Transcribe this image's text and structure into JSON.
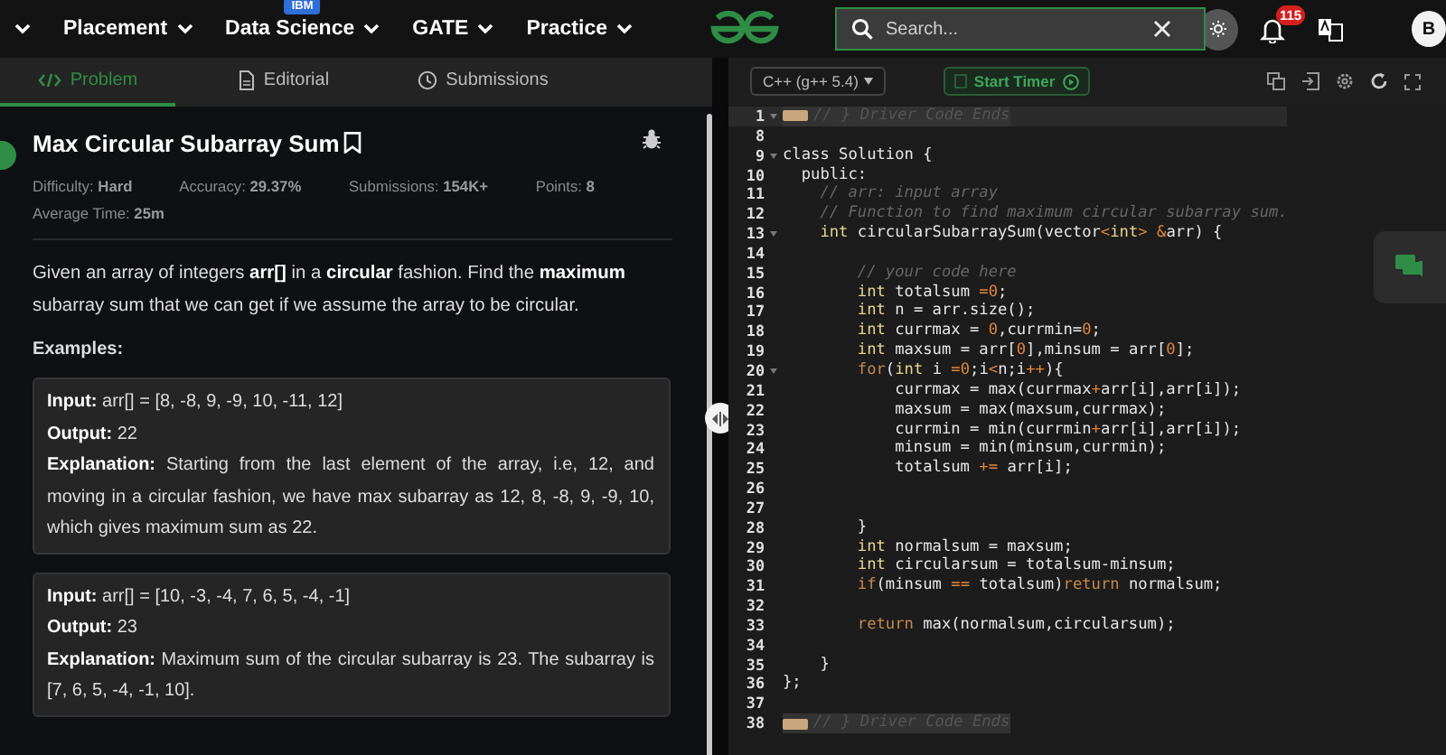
{
  "nav": {
    "links": [
      {
        "label": "Placement"
      },
      {
        "label": "Data Science",
        "badge": "IBM"
      },
      {
        "label": "GATE"
      },
      {
        "label": "Practice"
      }
    ],
    "search": {
      "placeholder": "Search..."
    },
    "notifications": {
      "count": "115"
    },
    "avatar": {
      "initial": "B"
    }
  },
  "tabs": [
    {
      "label": "Problem",
      "kind": "code",
      "selected": true
    },
    {
      "label": "Editorial",
      "kind": "document",
      "selected": false
    },
    {
      "label": "Submissions",
      "kind": "clock",
      "selected": false
    }
  ],
  "problem": {
    "title": "Max Circular Subarray Sum",
    "stats": [
      "Difficulty: **Hard**",
      "Accuracy: **29.37%**",
      "Submissions: **154K+**",
      "Points: **8**",
      "Average Time: **25m**"
    ],
    "description": "Given an array of integers **arr[]** in a **circular** fashion. Find the **maximum** subarray sum that we can get if we assume the array to be circular.",
    "examples_heading": "Examples:",
    "examples": [
      {
        "lines": [
          "**Input:** arr[] = [8, -8, 9, -9, 10, -11, 12]",
          "**Output:** 22",
          "**Explanation:** Starting from the last element of the array, i.e, 12, and moving in a circular fashion, we have max subarray as 12, 8, -8, 9, -9, 10, which gives maximum sum as 22."
        ]
      },
      {
        "lines": [
          "**Input:** arr[] = [10, -3, -4, 7, 6, 5, -4, -1]",
          "**Output:** 23",
          "**Explanation:** Maximum sum of the circular subarray is 23. The subarray is [7, 6, 5, -4, -1, 10]."
        ]
      }
    ]
  },
  "editor": {
    "language": "C++ (g++ 5.4)",
    "timer_button": "Start Timer",
    "lines": [
      {
        "number": "1",
        "kind": "folded",
        "foldable": true,
        "active": true,
        "tokens": [
          {
            "kind": "comment",
            "text": "// } Driver Code Ends"
          }
        ]
      },
      {
        "number": "8",
        "kind": "code",
        "foldable": false,
        "active": false
      },
      {
        "number": "9",
        "kind": "code",
        "foldable": true,
        "active": false,
        "tokens": [
          {
            "kind": "plain",
            "text": "class Solution {"
          }
        ]
      },
      {
        "number": "10",
        "kind": "code",
        "foldable": false,
        "active": false,
        "tokens": [
          {
            "kind": "plain",
            "text": "  public:"
          }
        ]
      },
      {
        "number": "11",
        "kind": "code",
        "foldable": false,
        "active": false,
        "tokens": [
          {
            "kind": "comment",
            "text": "    // arr: input array"
          }
        ]
      },
      {
        "number": "12",
        "kind": "code",
        "foldable": false,
        "active": false,
        "tokens": [
          {
            "kind": "comment",
            "text": "    // Function to find maximum circular subarray sum."
          }
        ]
      },
      {
        "number": "13",
        "kind": "code",
        "foldable": true,
        "active": false,
        "tokens": [
          {
            "kind": "type",
            "text": "    int"
          },
          {
            "kind": "plain",
            "text": " circularSubarraySum(vector"
          },
          {
            "kind": "operator",
            "text": "<"
          },
          {
            "kind": "type",
            "text": "int"
          },
          {
            "kind": "operator",
            "text": ">"
          },
          {
            "kind": "operator",
            "text": " &"
          },
          {
            "kind": "plain",
            "text": "arr) {"
          }
        ]
      },
      {
        "number": "14",
        "kind": "code",
        "foldable": false,
        "active": false
      },
      {
        "number": "15",
        "kind": "code",
        "foldable": false,
        "active": false,
        "tokens": [
          {
            "kind": "comment",
            "text": "        // your code here"
          }
        ]
      },
      {
        "number": "16",
        "kind": "code",
        "foldable": false,
        "active": false,
        "tokens": [
          {
            "kind": "type",
            "text": "        int"
          },
          {
            "kind": "plain",
            "text": " totalsum "
          },
          {
            "kind": "operator",
            "text": "=0"
          },
          {
            "kind": "plain",
            "text": ";"
          }
        ]
      },
      {
        "number": "17",
        "kind": "code",
        "foldable": false,
        "active": false,
        "tokens": [
          {
            "kind": "type",
            "text": "        int"
          },
          {
            "kind": "plain",
            "text": " n = arr.size();"
          }
        ]
      },
      {
        "number": "18",
        "kind": "code",
        "foldable": false,
        "active": false,
        "tokens": [
          {
            "kind": "type",
            "text": "        int"
          },
          {
            "kind": "plain",
            "text": " currmax = "
          },
          {
            "kind": "operator",
            "text": "0"
          },
          {
            "kind": "plain",
            "text": ",currmin="
          },
          {
            "kind": "operator",
            "text": "0"
          },
          {
            "kind": "plain",
            "text": ";"
          }
        ]
      },
      {
        "number": "19",
        "kind": "code",
        "foldable": false,
        "active": false,
        "tokens": [
          {
            "kind": "type",
            "text": "        int"
          },
          {
            "kind": "plain",
            "text": " maxsum = arr["
          },
          {
            "kind": "operator",
            "text": "0"
          },
          {
            "kind": "plain",
            "text": "],minsum = arr["
          },
          {
            "kind": "operator",
            "text": "0"
          },
          {
            "kind": "plain",
            "text": "];"
          }
        ]
      },
      {
        "number": "20",
        "kind": "code",
        "foldable": true,
        "active": false,
        "tokens": [
          {
            "kind": "control",
            "text": "        for"
          },
          {
            "kind": "plain",
            "text": "("
          },
          {
            "kind": "type",
            "text": "int"
          },
          {
            "kind": "plain",
            "text": " i "
          },
          {
            "kind": "operator",
            "text": "=0"
          },
          {
            "kind": "plain",
            "text": ";i"
          },
          {
            "kind": "operator",
            "text": "<"
          },
          {
            "kind": "plain",
            "text": "n;i"
          },
          {
            "kind": "operator",
            "text": "++"
          },
          {
            "kind": "plain",
            "text": "){"
          }
        ]
      },
      {
        "number": "21",
        "kind": "code",
        "foldable": false,
        "active": false,
        "tokens": [
          {
            "kind": "plain",
            "text": "            currmax = max(currmax"
          },
          {
            "kind": "operator",
            "text": "+"
          },
          {
            "kind": "plain",
            "text": "arr[i],arr[i]);"
          }
        ]
      },
      {
        "number": "22",
        "kind": "code",
        "foldable": false,
        "active": false,
        "tokens": [
          {
            "kind": "plain",
            "text": "            maxsum = max(maxsum,currmax);"
          }
        ]
      },
      {
        "number": "23",
        "kind": "code",
        "foldable": false,
        "active": false,
        "tokens": [
          {
            "kind": "plain",
            "text": "            currmin = min(currmin"
          },
          {
            "kind": "operator",
            "text": "+"
          },
          {
            "kind": "plain",
            "text": "arr[i],arr[i]);"
          }
        ]
      },
      {
        "number": "24",
        "kind": "code",
        "foldable": false,
        "active": false,
        "tokens": [
          {
            "kind": "plain",
            "text": "            minsum = min(minsum,currmin);"
          }
        ]
      },
      {
        "number": "25",
        "kind": "code",
        "foldable": false,
        "active": false,
        "tokens": [
          {
            "kind": "plain",
            "text": "            totalsum "
          },
          {
            "kind": "operator",
            "text": "+="
          },
          {
            "kind": "plain",
            "text": " arr[i];"
          }
        ]
      },
      {
        "number": "26",
        "kind": "code",
        "foldable": false,
        "active": false
      },
      {
        "number": "27",
        "kind": "code",
        "foldable": false,
        "active": false
      },
      {
        "number": "28",
        "kind": "code",
        "foldable": false,
        "active": false,
        "tokens": [
          {
            "kind": "plain",
            "text": "        }"
          }
        ]
      },
      {
        "number": "29",
        "kind": "code",
        "foldable": false,
        "active": false,
        "tokens": [
          {
            "kind": "type",
            "text": "        int"
          },
          {
            "kind": "plain",
            "text": " normalsum = maxsum;"
          }
        ]
      },
      {
        "number": "30",
        "kind": "code",
        "foldable": false,
        "active": false,
        "tokens": [
          {
            "kind": "type",
            "text": "        int"
          },
          {
            "kind": "plain",
            "text": " circularsum = totalsum-minsum;"
          }
        ]
      },
      {
        "number": "31",
        "kind": "code",
        "foldable": false,
        "active": false,
        "tokens": [
          {
            "kind": "control",
            "text": "        if"
          },
          {
            "kind": "plain",
            "text": "(minsum "
          },
          {
            "kind": "operator",
            "text": "=="
          },
          {
            "kind": "plain",
            "text": " totalsum)"
          },
          {
            "kind": "control",
            "text": "return"
          },
          {
            "kind": "plain",
            "text": " normalsum;"
          }
        ]
      },
      {
        "number": "32",
        "kind": "code",
        "foldable": false,
        "active": false
      },
      {
        "number": "33",
        "kind": "code",
        "foldable": false,
        "active": false,
        "tokens": [
          {
            "kind": "control",
            "text": "        return"
          },
          {
            "kind": "plain",
            "text": " max(normalsum,circularsum);"
          }
        ]
      },
      {
        "number": "34",
        "kind": "code",
        "foldable": false,
        "active": false
      },
      {
        "number": "35",
        "kind": "code",
        "foldable": false,
        "active": false,
        "tokens": [
          {
            "kind": "plain",
            "text": "    }"
          }
        ]
      },
      {
        "number": "36",
        "kind": "code",
        "foldable": false,
        "active": false,
        "tokens": [
          {
            "kind": "plain",
            "text": "};"
          }
        ]
      },
      {
        "number": "37",
        "kind": "code",
        "foldable": false,
        "active": false
      },
      {
        "number": "38",
        "kind": "folded",
        "foldable": false,
        "active": false,
        "tokens": [
          {
            "kind": "comment",
            "text": "// } Driver Code Ends"
          }
        ]
      }
    ]
  }
}
